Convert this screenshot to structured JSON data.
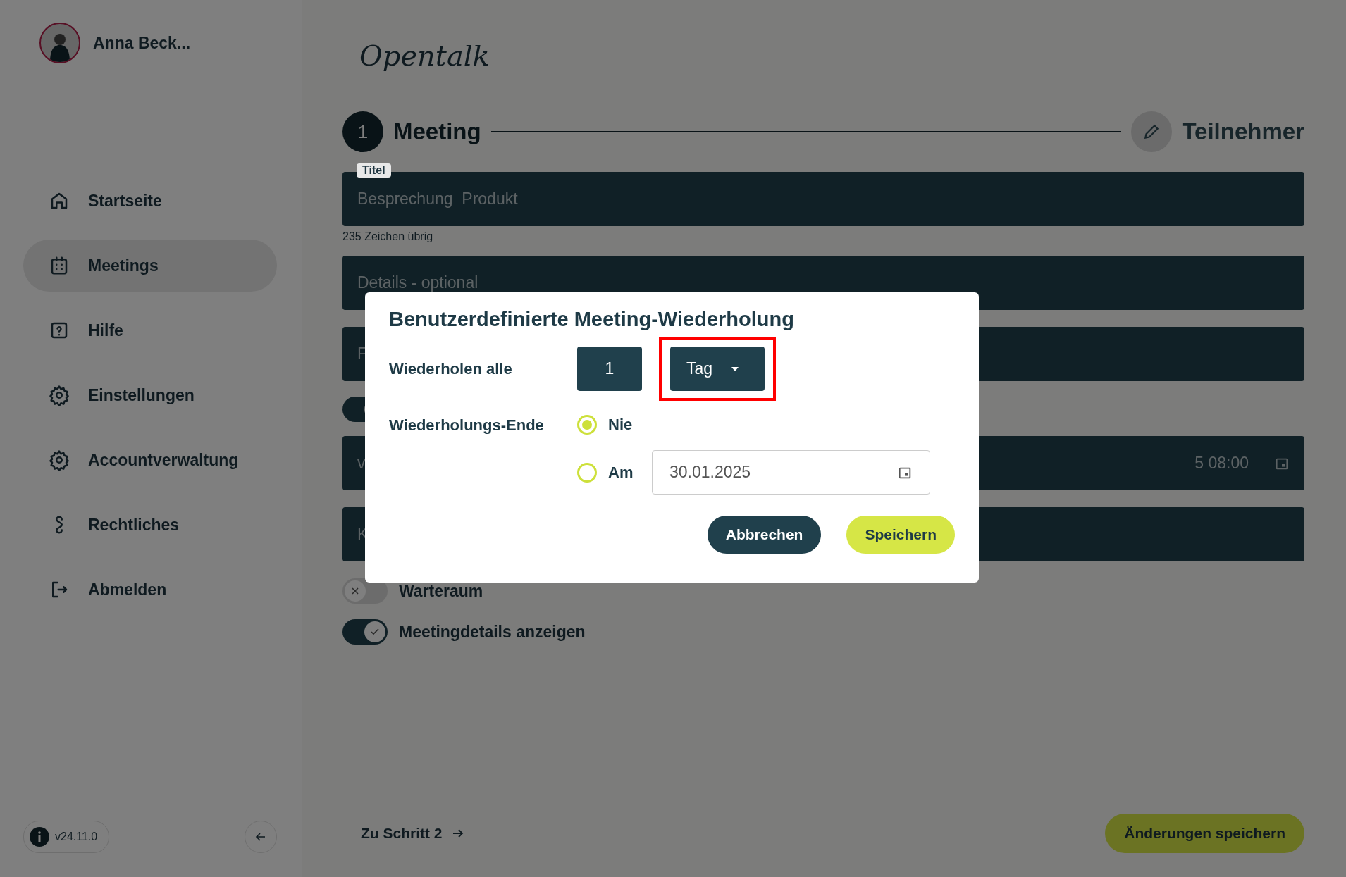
{
  "user": {
    "name": "Anna Beck..."
  },
  "sidebar": {
    "items": [
      {
        "label": "Startseite",
        "selected": false
      },
      {
        "label": "Meetings",
        "selected": true
      },
      {
        "label": "Hilfe",
        "selected": false
      },
      {
        "label": "Einstellungen",
        "selected": false
      },
      {
        "label": "Accountverwaltung",
        "selected": false
      },
      {
        "label": "Rechtliches",
        "selected": false
      },
      {
        "label": "Abmelden",
        "selected": false
      }
    ],
    "version": "v24.11.0"
  },
  "logo": "Opentalk",
  "stepper": [
    {
      "number": "1",
      "label": "Meeting",
      "selected": true
    },
    {
      "label": "Teilnehmer",
      "selected": false
    }
  ],
  "form": {
    "fields": [
      {
        "kind": "text",
        "label": "Titel",
        "value": "Besprechung  Produkt",
        "helper": "235 Zeichen übrig"
      },
      {
        "kind": "text",
        "placeholder": "Details - optional"
      },
      {
        "kind": "text",
        "value": "F"
      },
      {
        "kind": "switch",
        "on": true
      },
      {
        "kind": "date",
        "value": "v",
        "value_right": "5 08:00"
      },
      {
        "kind": "text",
        "value": "K"
      },
      {
        "kind": "switch",
        "label": "Warteraum",
        "on": false
      },
      {
        "kind": "switch",
        "label": "Meetingdetails anzeigen",
        "on": true
      }
    ]
  },
  "footer": {
    "next": "Zu Schritt 2",
    "save": "Änderungen speichern"
  },
  "dialog": {
    "title": "Benutzerdefinierte Meeting-Wiederholung",
    "repeat_label": "Wiederholen alle",
    "interval": "1",
    "unit": "Tag",
    "unit_highlighted": true,
    "end_label": "Wiederholungs-Ende",
    "end_options": [
      {
        "label": "Nie",
        "selected": true
      },
      {
        "label": "Am",
        "selected": false,
        "date": "30.01.2025"
      }
    ],
    "buttons": [
      {
        "label": "Abbrechen",
        "kind": "secondary"
      },
      {
        "label": "Speichern",
        "kind": "primary"
      }
    ]
  }
}
